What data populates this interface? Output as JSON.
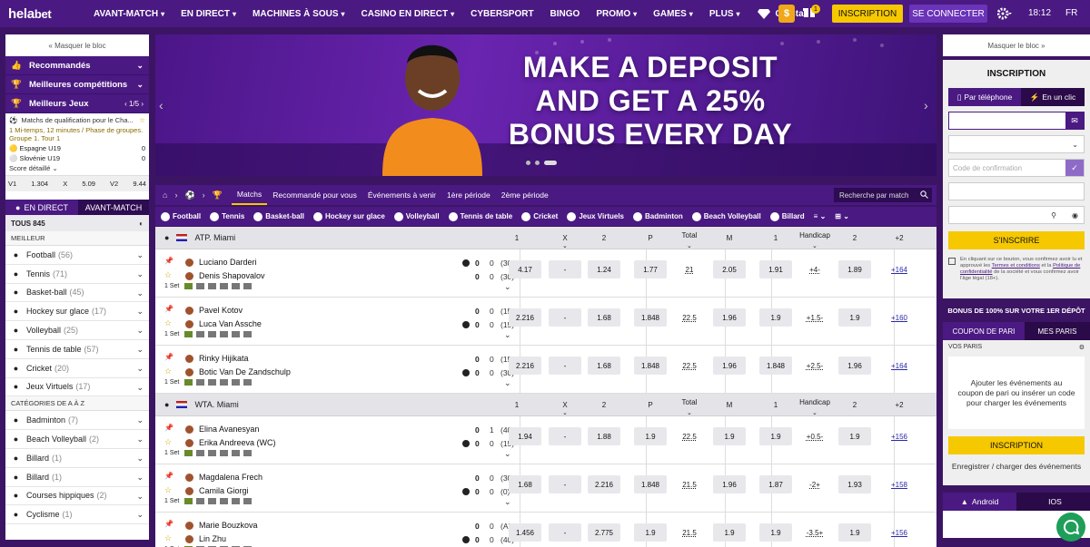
{
  "header": {
    "logo_a": "hela",
    "logo_b": "bet",
    "nav": [
      "AVANT-MATCH",
      "EN DIRECT",
      "MACHINES À SOUS",
      "CASINO EN DIRECT",
      "CYBERSPORT",
      "BINGO",
      "PROMO",
      "GAMES",
      "PLUS"
    ],
    "crystal": "Crystal",
    "dollar": "$",
    "gift_count": "1",
    "inscription": "INSCRIPTION",
    "connect": "SE CONNECTER",
    "time": "18:12",
    "lang": "FR"
  },
  "left": {
    "hide": "« Masquer le bloc",
    "menu": [
      "Recommandés",
      "Meilleures compétitions",
      "Meilleurs Jeux"
    ],
    "pager": "1/5",
    "mj_title": "Matchs de qualification pour le Cha...",
    "mj_info": "1 Mi-temps, 12 minutes / Phase de groupes. Groupe 1. Tour 1",
    "team1": "Espagne U19",
    "score1": "0",
    "team2": "Slovénie U19",
    "score2": "0",
    "detail": "Score détaillé",
    "odds": [
      "V1",
      "1.304",
      "X",
      "5.09",
      "V2",
      "9.44"
    ],
    "tab_live": "EN DIRECT",
    "tab_pre": "AVANT-MATCH",
    "tous": "TOUS 845",
    "best": "MEILLEUR",
    "sports": [
      {
        "n": "Football",
        "c": "(56)"
      },
      {
        "n": "Tennis",
        "c": "(71)"
      },
      {
        "n": "Basket-ball",
        "c": "(45)"
      },
      {
        "n": "Hockey sur glace",
        "c": "(17)"
      },
      {
        "n": "Volleyball",
        "c": "(25)"
      },
      {
        "n": "Tennis de table",
        "c": "(57)"
      },
      {
        "n": "Cricket",
        "c": "(20)"
      },
      {
        "n": "Jeux Virtuels",
        "c": "(17)"
      }
    ],
    "cat_header": "CATÉGORIES DE A À Z",
    "cats": [
      {
        "n": "Badminton",
        "c": "(7)"
      },
      {
        "n": "Beach Volleyball",
        "c": "(2)"
      },
      {
        "n": "Billard",
        "c": "(1)"
      },
      {
        "n": "Billard",
        "c": "(1)"
      },
      {
        "n": "Courses hippiques",
        "c": "(2)"
      },
      {
        "n": "Cyclisme",
        "c": "(1)"
      }
    ]
  },
  "banner": {
    "line1": "MAKE A DEPOSIT",
    "line2": "AND GET A 25%",
    "line3": "BONUS EVERY DAY"
  },
  "main": {
    "tabs": [
      "Matchs",
      "Recommandé pour vous",
      "Événements à venir",
      "1ère période",
      "2ème période"
    ],
    "search_placeholder": "Recherche par match",
    "sports": [
      "Football",
      "Tennis",
      "Basket-ball",
      "Hockey sur glace",
      "Volleyball",
      "Tennis de table",
      "Cricket",
      "Jeux Virtuels",
      "Badminton",
      "Beach Volleyball",
      "Billard"
    ],
    "headers": {
      "c1": "1",
      "cx": "X",
      "c2": "2",
      "p": "P",
      "total": "Total",
      "m": "M",
      "h1": "1",
      "hand": "Handicap",
      "h2": "2",
      "plus": "+2"
    },
    "set_label": "1 Set",
    "leagues": [
      {
        "name": "ATP. Miami",
        "matches": [
          {
            "p1": "Luciano Darderi",
            "p2": "Denis Shapovalov",
            "s1a": "0",
            "s1b": "0",
            "s1c": "(30)",
            "s2a": "0",
            "s2b": "0",
            "s2c": "(30)",
            "o1": "4.17",
            "ox": "-",
            "o2": "1.24",
            "p": "1.77",
            "total": "21",
            "m": "2.05",
            "h1": "1.91",
            "hand": "+4-",
            "h2": "1.89",
            "more": "+164"
          },
          {
            "p1": "Pavel Kotov",
            "p2": "Luca Van Assche",
            "s1a": "0",
            "s1b": "0",
            "s1c": "(15)",
            "s2a": "0",
            "s2b": "0",
            "s2c": "(15)",
            "o1": "2.216",
            "ox": "-",
            "o2": "1.68",
            "p": "1.848",
            "total": "22.5",
            "m": "1.96",
            "h1": "1.9",
            "hand": "+1.5-",
            "h2": "1.9",
            "more": "+160"
          },
          {
            "p1": "Rinky Hijikata",
            "p2": "Botic Van De Zandschulp",
            "s1a": "0",
            "s1b": "0",
            "s1c": "(15)",
            "s2a": "0",
            "s2b": "0",
            "s2c": "(30)",
            "o1": "2.216",
            "ox": "-",
            "o2": "1.68",
            "p": "1.848",
            "total": "22.5",
            "m": "1.96",
            "h1": "1.848",
            "hand": "+2.5-",
            "h2": "1.96",
            "more": "+164"
          }
        ]
      },
      {
        "name": "WTA. Miami",
        "matches": [
          {
            "p1": "Elina Avanesyan",
            "p2": "Erika Andreeva (WC)",
            "s1a": "0",
            "s1b": "1",
            "s1c": "(40)",
            "s2a": "0",
            "s2b": "0",
            "s2c": "(15)",
            "o1": "1.94",
            "ox": "-",
            "o2": "1.88",
            "p": "1.9",
            "total": "22.5",
            "m": "1.9",
            "h1": "1.9",
            "hand": "+0.5-",
            "h2": "1.9",
            "more": "+156"
          },
          {
            "p1": "Magdalena Frech",
            "p2": "Camila Giorgi",
            "s1a": "0",
            "s1b": "0",
            "s1c": "(30)",
            "s2a": "0",
            "s2b": "0",
            "s2c": "(0)",
            "o1": "1.68",
            "ox": "-",
            "o2": "2.216",
            "p": "1.848",
            "total": "21.5",
            "m": "1.96",
            "h1": "1.87",
            "hand": "-2+",
            "h2": "1.93",
            "more": "+158"
          },
          {
            "p1": "Marie Bouzkova",
            "p2": "Lin Zhu",
            "s1a": "0",
            "s1b": "0",
            "s1c": "(A)",
            "s2a": "0",
            "s2b": "0",
            "s2c": "(40)",
            "o1": "1.456",
            "ox": "-",
            "o2": "2.775",
            "p": "1.9",
            "total": "21.5",
            "m": "1.9",
            "h1": "1.9",
            "hand": "-3.5+",
            "h2": "1.9",
            "more": "+156"
          }
        ]
      }
    ]
  },
  "right": {
    "hide": "Masquer le bloc »",
    "title": "INSCRIPTION",
    "tab_phone": "Par téléphone",
    "tab_click": "En un clic",
    "code_placeholder": "Code de confirmation",
    "register": "S'INSCRIRE",
    "consent_a": "En cliquant sur ce bouton, vous confirmez avoir lu et approuvé les ",
    "consent_link1": "Termes et conditions",
    "consent_b": " et la ",
    "consent_link2": "Politique de confidentialité",
    "consent_c": " de la société et vous confirmez avoir l'âge légal (18+).",
    "bonus": "BONUS DE 100% SUR VOTRE 1ER DÉPÔT",
    "coupon_tab": "COUPON DE PARI",
    "bets_tab": "MES PARIS",
    "vos_paris": "VOS PARIS",
    "coupon_msg": "Ajouter les événements au coupon de pari ou insérer un code pour charger les événements",
    "coupon_ins": "INSCRIPTION",
    "coupon_reg": "Enregistrer / charger des événements",
    "android": "Android",
    "ios": "IOS"
  },
  "colors": {
    "brand": "#4a1982",
    "accent": "#f6c800",
    "dark": "#3c1464"
  }
}
